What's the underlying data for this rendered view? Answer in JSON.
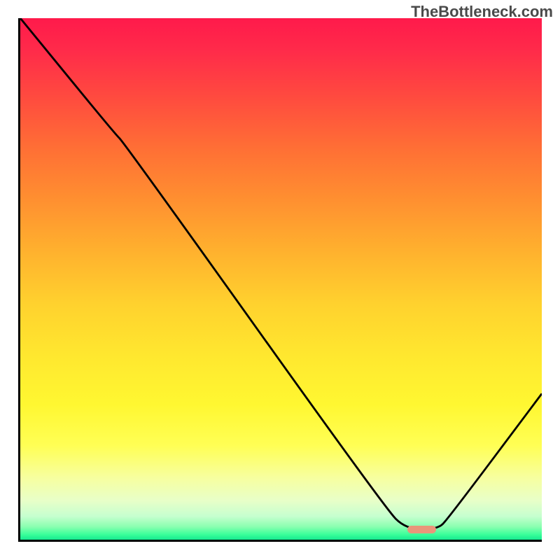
{
  "watermark": "TheBottleneck.com",
  "chart_data": {
    "type": "line",
    "title": "",
    "xlabel": "",
    "ylabel": "",
    "xlim": [
      0,
      100
    ],
    "ylim": [
      0,
      100
    ],
    "grid": false,
    "background_gradient": {
      "stops": [
        {
          "offset": 0.0,
          "color": "#ff1a4b"
        },
        {
          "offset": 0.06,
          "color": "#ff2a4a"
        },
        {
          "offset": 0.15,
          "color": "#ff4a3f"
        },
        {
          "offset": 0.25,
          "color": "#ff6f35"
        },
        {
          "offset": 0.35,
          "color": "#ff9030"
        },
        {
          "offset": 0.45,
          "color": "#ffb22e"
        },
        {
          "offset": 0.55,
          "color": "#ffd22e"
        },
        {
          "offset": 0.65,
          "color": "#ffe82f"
        },
        {
          "offset": 0.74,
          "color": "#fff731"
        },
        {
          "offset": 0.82,
          "color": "#ffff55"
        },
        {
          "offset": 0.88,
          "color": "#f7ff9e"
        },
        {
          "offset": 0.925,
          "color": "#e8ffc8"
        },
        {
          "offset": 0.955,
          "color": "#c6ffcf"
        },
        {
          "offset": 0.975,
          "color": "#8affb0"
        },
        {
          "offset": 0.99,
          "color": "#3aff9a"
        },
        {
          "offset": 1.0,
          "color": "#17e890"
        }
      ]
    },
    "series": [
      {
        "name": "bottleneck-curve",
        "color": "#000000",
        "x": [
          0,
          18,
          20,
          70,
          74,
          80,
          82,
          100
        ],
        "y": [
          100,
          78,
          76,
          6,
          2,
          2,
          4,
          28
        ]
      }
    ],
    "marker": {
      "name": "optimal-range-marker",
      "color": "#e9967a",
      "x_center": 77,
      "y": 2,
      "width_x_units": 5.5,
      "height_y_units": 1.5
    }
  }
}
